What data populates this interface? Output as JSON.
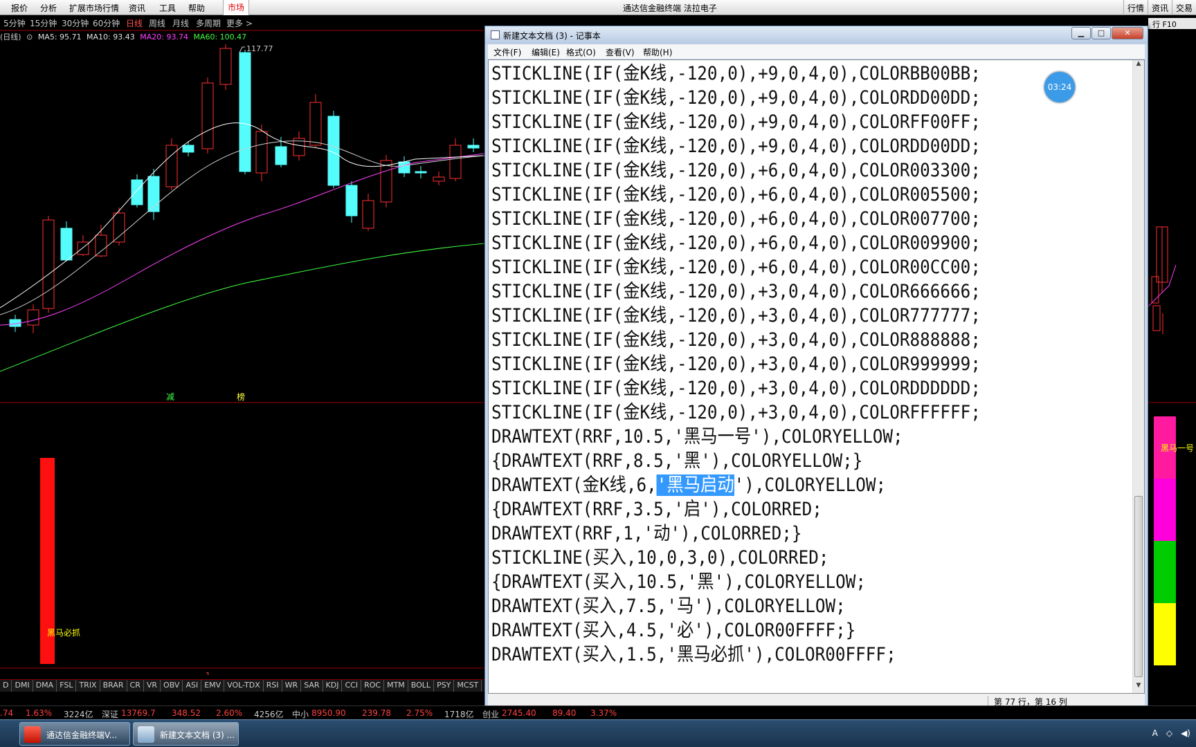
{
  "menubar": {
    "items": [
      "报价",
      "分析",
      "扩展市场行情",
      "资讯",
      "工具",
      "帮助"
    ],
    "active_item": "市场",
    "app_title": "通达信金融终端 法拉电子",
    "right_buttons": [
      "行情",
      "资讯",
      "交易"
    ]
  },
  "periodbar": {
    "items": [
      "5分钟",
      "15分钟",
      "30分钟",
      "60分钟",
      "日线",
      "周线",
      "月线",
      "多周期",
      "更多 >"
    ],
    "selected": "日线"
  },
  "chart": {
    "period_label": "(日线)",
    "ma": [
      {
        "label": "MA5: 95.71",
        "color": "#e0e0e0"
      },
      {
        "label": "MA10: 93.43",
        "color": "#e0e0e0"
      },
      {
        "label": "MA20: 93.74",
        "color": "#ff40ff"
      },
      {
        "label": "MA60: 100.47",
        "color": "#40ff40"
      }
    ],
    "high_label": "117.77",
    "markers": [
      "减",
      "榜"
    ],
    "signal_label": "黑马必抓",
    "right_signal_label": "黑马一号",
    "colors": {
      "up": "#ff3030",
      "down": "#54fcfc",
      "ma5": "#ffffff",
      "ma10": "#d0d0d0",
      "ma20": "#ff40ff",
      "ma60": "#40ff40",
      "grid": "#a00000"
    }
  },
  "indicator_tabs": [
    "D",
    "DMI",
    "DMA",
    "FSL",
    "TRIX",
    "BRAR",
    "CR",
    "VR",
    "OBV",
    "ASI",
    "EMV",
    "VOL-TDX",
    "RSI",
    "WR",
    "SAR",
    "KDJ",
    "CCI",
    "ROC",
    "MTM",
    "BOLL",
    "PSY",
    "MCST"
  ],
  "ticker": [
    {
      "text": ".74",
      "color": "#ff4040"
    },
    {
      "text": "1.63%",
      "color": "#ff4040"
    },
    {
      "text": "3224亿",
      "color": "#cccccc"
    },
    {
      "text": "深证",
      "color": "#cccccc"
    },
    {
      "text": "13769.7",
      "color": "#ff4040"
    },
    {
      "text": "348.52",
      "color": "#ff4040"
    },
    {
      "text": "2.60%",
      "color": "#ff4040"
    },
    {
      "text": "4256亿",
      "color": "#cccccc"
    },
    {
      "text": "中小",
      "color": "#cccccc"
    },
    {
      "text": "8950.90",
      "color": "#ff4040"
    },
    {
      "text": "239.78",
      "color": "#ff4040"
    },
    {
      "text": "2.75%",
      "color": "#ff4040"
    },
    {
      "text": "1718亿",
      "color": "#cccccc"
    },
    {
      "text": "创业",
      "color": "#cccccc"
    },
    {
      "text": "2745.40",
      "color": "#ff4040"
    },
    {
      "text": "89.40",
      "color": "#ff4040"
    },
    {
      "text": "3.37%",
      "color": "#ff4040"
    }
  ],
  "notepad": {
    "title": "新建文本文档 (3) - 记事本",
    "menu": [
      "文件(F)",
      "编辑(E)",
      "格式(O)",
      "查看(V)",
      "帮助(H)"
    ],
    "lines": [
      "STICKLINE(IF(金K线,-120,0),+9,0,4,0),COLORBB00BB;",
      "STICKLINE(IF(金K线,-120,0),+9,0,4,0),COLORDD00DD;",
      "STICKLINE(IF(金K线,-120,0),+9,0,4,0),COLORFF00FF;",
      "STICKLINE(IF(金K线,-120,0),+9,0,4,0),COLORDD00DD;",
      "STICKLINE(IF(金K线,-120,0),+6,0,4,0),COLOR003300;",
      "STICKLINE(IF(金K线,-120,0),+6,0,4,0),COLOR005500;",
      "STICKLINE(IF(金K线,-120,0),+6,0,4,0),COLOR007700;",
      "STICKLINE(IF(金K线,-120,0),+6,0,4,0),COLOR009900;",
      "STICKLINE(IF(金K线,-120,0),+6,0,4,0),COLOR00CC00;",
      "STICKLINE(IF(金K线,-120,0),+3,0,4,0),COLOR666666;",
      "STICKLINE(IF(金K线,-120,0),+3,0,4,0),COLOR777777;",
      "STICKLINE(IF(金K线,-120,0),+3,0,4,0),COLOR888888;",
      "STICKLINE(IF(金K线,-120,0),+3,0,4,0),COLOR999999;",
      "STICKLINE(IF(金K线,-120,0),+3,0,4,0),COLORDDDDDD;",
      "STICKLINE(IF(金K线,-120,0),+3,0,4,0),COLORFFFFFF;",
      "DRAWTEXT(RRF,10.5,'黑马一号'),COLORYELLOW;",
      "{DRAWTEXT(RRF,8.5,'黑'),COLORYELLOW;}",
      "DRAWTEXT(金K线,6,'黑马启动'),COLORYELLOW;",
      "{DRAWTEXT(RRF,3.5,'启'),COLORRED;",
      "DRAWTEXT(RRF,1,'动'),COLORRED;}",
      "STICKLINE(买入,10,0,3,0),COLORRED;",
      "{DRAWTEXT(买入,10.5,'黑'),COLORYELLOW;",
      "DRAWTEXT(买入,7.5,'马'),COLORYELLOW;",
      "DRAWTEXT(买入,4.5,'必'),COLOR00FFFF;}",
      "DRAWTEXT(买入,1.5,'黑马必抓'),COLOR00FFFF;"
    ],
    "selection": {
      "line": 17,
      "text": "'黑马启动"
    },
    "status": "第 77 行，第 16 列"
  },
  "timer": "03:24",
  "taskbar": {
    "tasks": [
      "通达信金融终端V...",
      "新建文本文档 (3) ..."
    ]
  }
}
